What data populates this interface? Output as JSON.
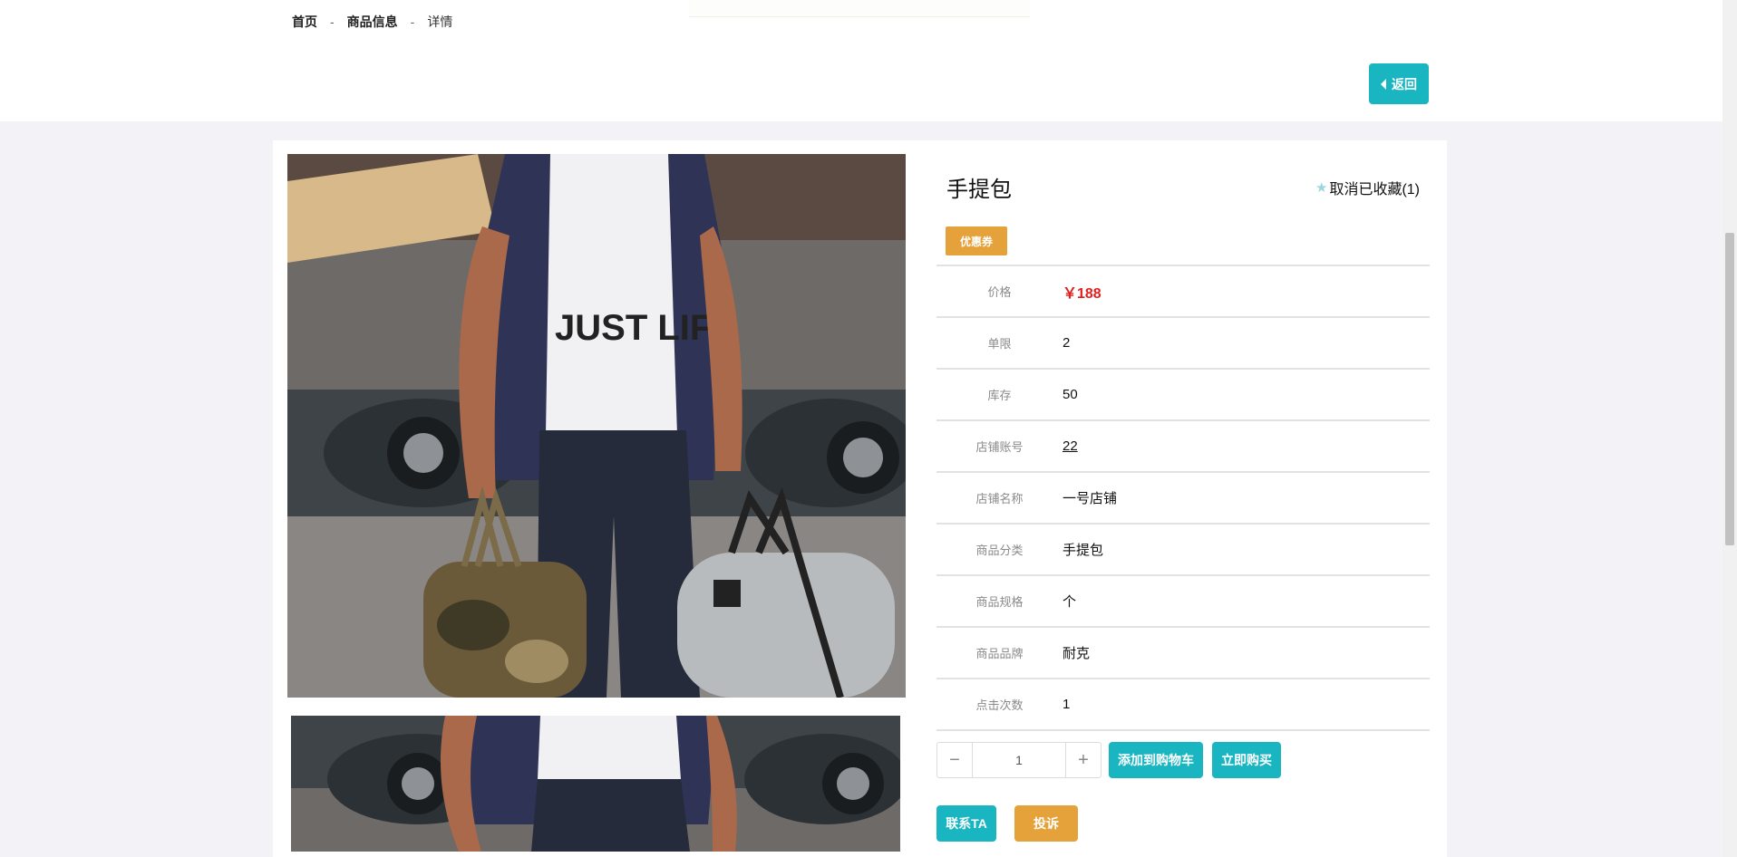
{
  "breadcrumb": {
    "home": "首页",
    "separator": "-",
    "section": "商品信息",
    "current": "详情"
  },
  "back_button": {
    "label": "返回",
    "icon": "caret-left-icon"
  },
  "product": {
    "title": "手提包",
    "favorite": {
      "label": "取消已收藏(1)",
      "icon": "star-icon"
    },
    "coupon_label": "优惠券",
    "images": {
      "main": "product-main-photo",
      "thumbnail": "product-thumbnail-photo"
    },
    "details": [
      {
        "label": "价格",
        "value": "￥188"
      },
      {
        "label": "单限",
        "value": "2"
      },
      {
        "label": "库存",
        "value": "50"
      },
      {
        "label": "店铺账号",
        "value": "22"
      },
      {
        "label": "店铺名称",
        "value": "一号店铺"
      },
      {
        "label": "商品分类",
        "value": "手提包"
      },
      {
        "label": "商品规格",
        "value": "个"
      },
      {
        "label": "商品品牌",
        "value": "耐克"
      },
      {
        "label": "点击次数",
        "value": "1"
      }
    ]
  },
  "purchase": {
    "quantity": "1",
    "minus_icon": "minus-icon",
    "plus_icon": "plus-icon",
    "add_to_cart_label": "添加到购物车",
    "buy_now_label": "立即购买",
    "contact_label": "联系TA",
    "complaint_label": "投诉"
  },
  "colors": {
    "accent": "#19b6c2",
    "warning": "#e5a23a",
    "price": "#e02020",
    "page_bg": "#f3f3f7"
  }
}
